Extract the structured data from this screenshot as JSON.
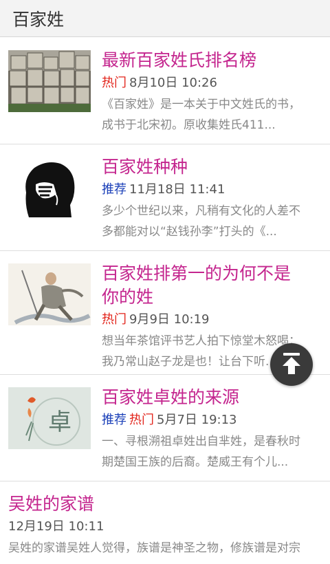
{
  "header": {
    "title": "百家姓"
  },
  "articles": [
    {
      "title": "最新百家姓氏排名榜",
      "tags": [
        {
          "text": "热门",
          "kind": "hot"
        }
      ],
      "date": "8月10日 10:26",
      "desc": [
        "《百家姓》是一本关于中文姓氏的书，",
        "成书于北宋初。原收集姓氏411..."
      ]
    },
    {
      "title": "百家姓种种",
      "tags": [
        {
          "text": "推荐",
          "kind": "rec"
        }
      ],
      "date": "11月18日 11:41",
      "desc": [
        "多少个世纪以来，凡稍有文化的人差不",
        "多都能对以“赵钱孙李”打头的《..."
      ]
    },
    {
      "title_lines": [
        "百家姓排第一的为何不是",
        "你的姓"
      ],
      "tags": [
        {
          "text": "热门",
          "kind": "hot"
        }
      ],
      "date": "9月9日 10:19",
      "desc": [
        "想当年茶馆评书艺人拍下惊堂木怒喝：",
        "我乃常山赵子龙是也！让台下听..."
      ]
    },
    {
      "title": "百家姓卓姓的来源",
      "tags": [
        {
          "text": "推荐",
          "kind": "rec"
        },
        {
          "text": "热门",
          "kind": "hot"
        }
      ],
      "date": "5月7日 19:13",
      "desc": [
        "一、寻根溯祖卓姓出自芈姓，是春秋时",
        "期楚国王族的后裔。楚威王有个儿..."
      ],
      "thumb_char": "卓"
    },
    {
      "title": "吴姓的家谱",
      "date": "12月19日 10:11",
      "desc": [
        "吴姓的家谱吴姓人觉得，族谱是神圣之物，修族谱是对宗"
      ]
    }
  ],
  "colors": {
    "title": "#c4258e",
    "hot": "#e2231a",
    "rec": "#1a3fb8"
  },
  "icons": {
    "back_to_top": "arrow-up-to-top-icon"
  }
}
